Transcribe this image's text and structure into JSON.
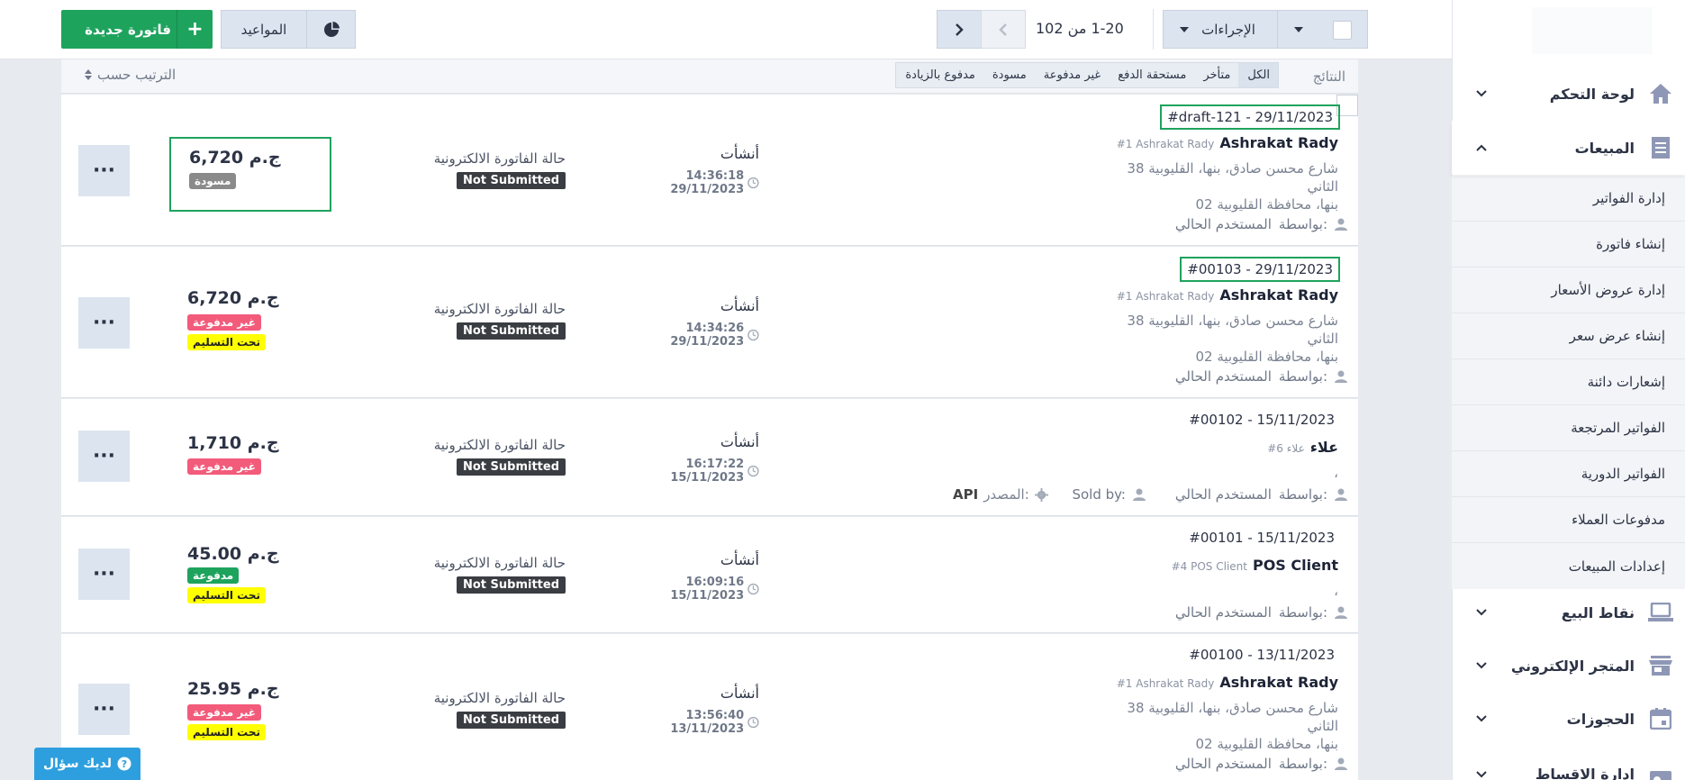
{
  "toolbar": {
    "new_invoice": "فاتورة جديدة",
    "appointments": "المواعيد",
    "pagination": "1-20  من 102",
    "actions": "الإجراءات"
  },
  "filterbar": {
    "results_label": "النتائج",
    "sort_label": "الترتيب حسب",
    "filters": [
      "الكل",
      "متأخر",
      "مستحقة الدفع",
      "غير مدفوعة",
      "مسودة",
      "مدفوع بالزيادة"
    ]
  },
  "invoices": [
    {
      "number": "#draft-121 - 29/11/2023",
      "client": "Ashrakat Rady",
      "client_ref": "#1 Ashrakat Rady",
      "addr1": "38 شارع محسن صادق، بنها، القليوبية",
      "addr2": "الثاني",
      "addr3": "بنها، محافظة القليوبية 02",
      "by_label": "بواسطة:",
      "by_value": "المستخدم الحالي",
      "created_label": "أنشأت",
      "created_at": "14:36:18 29/11/2023",
      "einvoice_label": "حالة الفاتورة الالكترونية",
      "einvoice_status": "Not Submitted",
      "amount": "6,720 ج.م",
      "tag1": "مسودة",
      "tag2": ""
    },
    {
      "number": "#00103 - 29/11/2023",
      "client": "Ashrakat Rady",
      "client_ref": "#1 Ashrakat Rady",
      "addr1": "38 شارع محسن صادق، بنها، القليوبية",
      "addr2": "الثاني",
      "addr3": "بنها، محافظة القليوبية 02",
      "by_label": "بواسطة:",
      "by_value": "المستخدم الحالي",
      "created_label": "أنشأت",
      "created_at": "14:34:26 29/11/2023",
      "einvoice_label": "حالة الفاتورة الالكترونية",
      "einvoice_status": "Not Submitted",
      "amount": "6,720 ج.م",
      "tag1": "غير مدفوعة",
      "tag2": "تحت التسليم"
    },
    {
      "number": "#00102 - 15/11/2023",
      "client": "علاء",
      "client_ref": "#6 علاء",
      "comma": "،",
      "by_label": "بواسطة:",
      "by_value": "المستخدم الحالي",
      "sold_by": "Sold by:",
      "source_label": "المصدر:",
      "source_value": "API",
      "created_label": "أنشأت",
      "created_at": "16:17:22 15/11/2023",
      "einvoice_label": "حالة الفاتورة الالكترونية",
      "einvoice_status": "Not Submitted",
      "amount": "1,710 ج.م",
      "tag1": "غير مدفوعة",
      "tag2": ""
    },
    {
      "number": "#00101 - 15/11/2023",
      "client": "POS Client",
      "client_ref": "#4 POS Client",
      "comma": "،",
      "by_label": "بواسطة:",
      "by_value": "المستخدم الحالي",
      "created_label": "أنشأت",
      "created_at": "16:09:16 15/11/2023",
      "einvoice_label": "حالة الفاتورة الالكترونية",
      "einvoice_status": "Not Submitted",
      "amount": "45.00 ج.م",
      "tag1": "مدفوعة",
      "tag2": "تحت التسليم"
    },
    {
      "number": "#00100 - 13/11/2023",
      "client": "Ashrakat Rady",
      "client_ref": "#1 Ashrakat Rady",
      "addr1": "38 شارع محسن صادق، بنها، القليوبية",
      "addr2": "الثاني",
      "addr3": "بنها، محافظة القليوبية 02",
      "by_label": "بواسطة:",
      "by_value": "المستخدم الحالي",
      "created_label": "أنشأت",
      "created_at": "13:56:40 13/11/2023",
      "einvoice_label": "حالة الفاتورة الالكترونية",
      "einvoice_status": "Not Submitted",
      "amount": "25.95 ج.م",
      "tag1": "غير مدفوعة",
      "tag2": "تحت التسليم"
    }
  ],
  "sidebar": {
    "dashboard": "لوحة التحكم",
    "sales": "المبيعات",
    "sales_items": [
      "إدارة الفواتير",
      "إنشاء فاتورة",
      "إدارة عروض الأسعار",
      "إنشاء عرض سعر",
      "إشعارات دائنة",
      "الفواتير المرتجعة",
      "الفواتير الدورية",
      "مدفوعات العملاء",
      "إعدادات المبيعات"
    ],
    "pos": "نقاط البيع",
    "estore": "المتجر الإلكتروني",
    "bookings": "الحجوزات",
    "installments": "إدارة الاقساط"
  },
  "help": {
    "label": "لديك سؤال"
  },
  "colors": {
    "primary": "#1ea35d",
    "unpaid": "#f35b7b",
    "draft": "#8a8a8a",
    "delivery": "#ffff00",
    "help": "#2e9fde"
  }
}
